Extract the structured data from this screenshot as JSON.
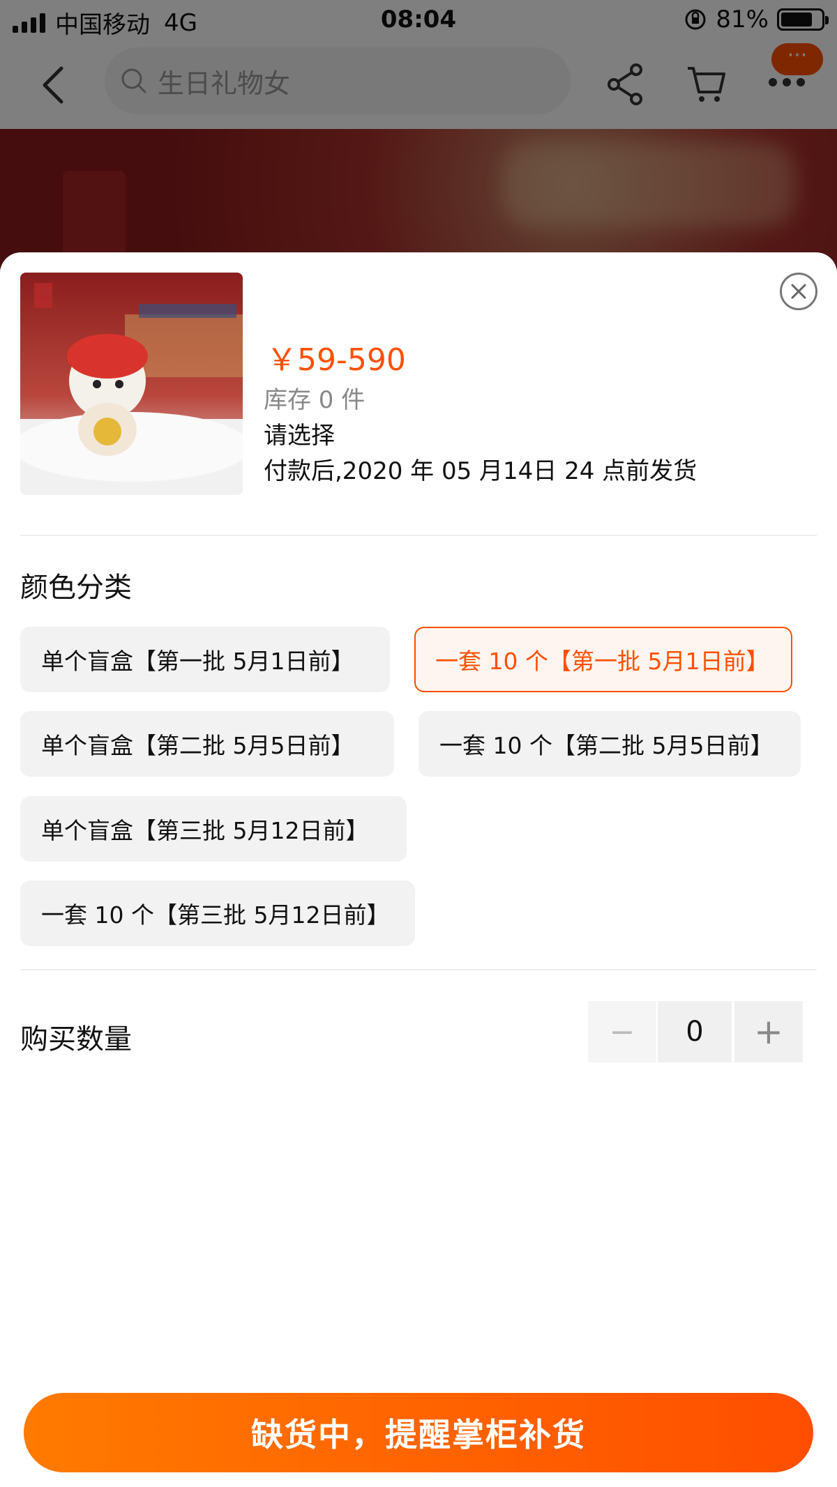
{
  "status_bar": {
    "carrier": "中国移动",
    "network": "4G",
    "time": "08:04",
    "battery": "81%"
  },
  "nav": {
    "search_placeholder": "生日礼物女",
    "more_badge": "···"
  },
  "product": {
    "price": "￥59-590",
    "stock": "库存 0 件",
    "select_prompt": "请选择",
    "ship_note": "付款后,2020 年 05 月14日 24 点前发货"
  },
  "variants": {
    "title": "颜色分类",
    "options": [
      "单个盲盒【第一批 5月1日前】",
      "一套 10 个【第一批 5月1日前】",
      "单个盲盒【第二批 5月5日前】",
      "一套 10 个【第二批 5月5日前】",
      "单个盲盒【第三批 5月12日前】",
      "一套 10 个【第三批 5月12日前】"
    ],
    "selected_index": 1
  },
  "quantity": {
    "label": "购买数量",
    "minus": "−",
    "value": "0",
    "plus": "+"
  },
  "cta": {
    "label": "缺货中，提醒掌柜补货"
  },
  "colors": {
    "accent": "#ff5000",
    "chip_bg": "#f2f2f2",
    "overlay": "rgba(0,0,0,0.5)"
  }
}
